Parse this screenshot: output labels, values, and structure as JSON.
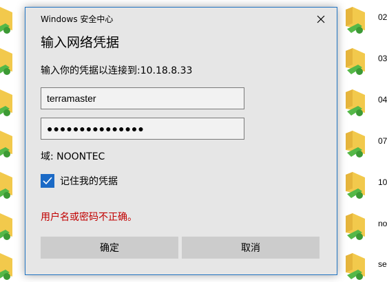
{
  "background": {
    "file_labels": [
      "02",
      "03",
      "04",
      "07",
      "10",
      "no",
      "se"
    ]
  },
  "dialog": {
    "window_title": "Windows 安全中心",
    "heading": "输入网络凭据",
    "prompt": "输入你的凭据以连接到:10.18.8.33",
    "username_value": "terramaster",
    "password_mask": "●●●●●●●●●●●●●●●",
    "domain": "域: NOONTEC",
    "remember_label": "记住我的凭据",
    "remember_checked": true,
    "error_message": "用户名或密码不正确。",
    "ok_label": "确定",
    "cancel_label": "取消",
    "accent_color": "#1b6ac6",
    "error_color": "#c10000"
  }
}
